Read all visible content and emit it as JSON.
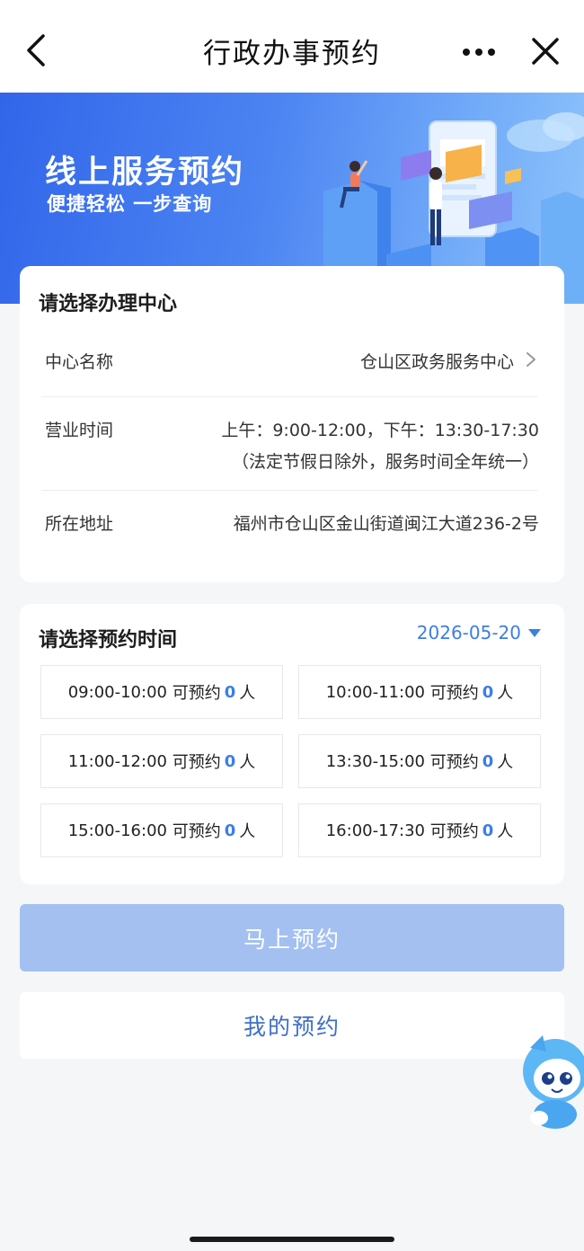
{
  "nav": {
    "title": "行政办事预约",
    "back_icon": "chevron-left-icon",
    "more_icon": "more-dots-icon",
    "close_icon": "close-icon"
  },
  "banner": {
    "headline": "线上服务预约",
    "subline": "便捷轻松 一步查询"
  },
  "center": {
    "section_title": "请选择办理中心",
    "name_label": "中心名称",
    "name_value": "仓山区政务服务中心",
    "hours_label": "营业时间",
    "hours_value": "上午：9:00-12:00，下午：13:30-17:30",
    "hours_note": "（法定节假日除外，服务时间全年统一）",
    "address_label": "所在地址",
    "address_value": "福州市仓山区金山街道闽江大道236-2号"
  },
  "schedule": {
    "section_title": "请选择预约时间",
    "date": "2026-05-20",
    "slots": [
      {
        "time": "09:00-10:00",
        "prefix": "可预约",
        "count": "0",
        "suffix": "人"
      },
      {
        "time": "10:00-11:00",
        "prefix": "可预约",
        "count": "0",
        "suffix": "人"
      },
      {
        "time": "11:00-12:00",
        "prefix": "可预约",
        "count": "0",
        "suffix": "人"
      },
      {
        "time": "13:30-15:00",
        "prefix": "可预约",
        "count": "0",
        "suffix": "人"
      },
      {
        "time": "15:00-16:00",
        "prefix": "可预约",
        "count": "0",
        "suffix": "人"
      },
      {
        "time": "16:00-17:30",
        "prefix": "可预约",
        "count": "0",
        "suffix": "人"
      }
    ]
  },
  "actions": {
    "book_now": "马上预约",
    "my_bookings": "我的预约"
  },
  "colors": {
    "accent": "#3d7ee6",
    "button_disabled": "#a3c0f1",
    "banner_start": "#3266ea",
    "banner_end": "#8ec4fb"
  }
}
